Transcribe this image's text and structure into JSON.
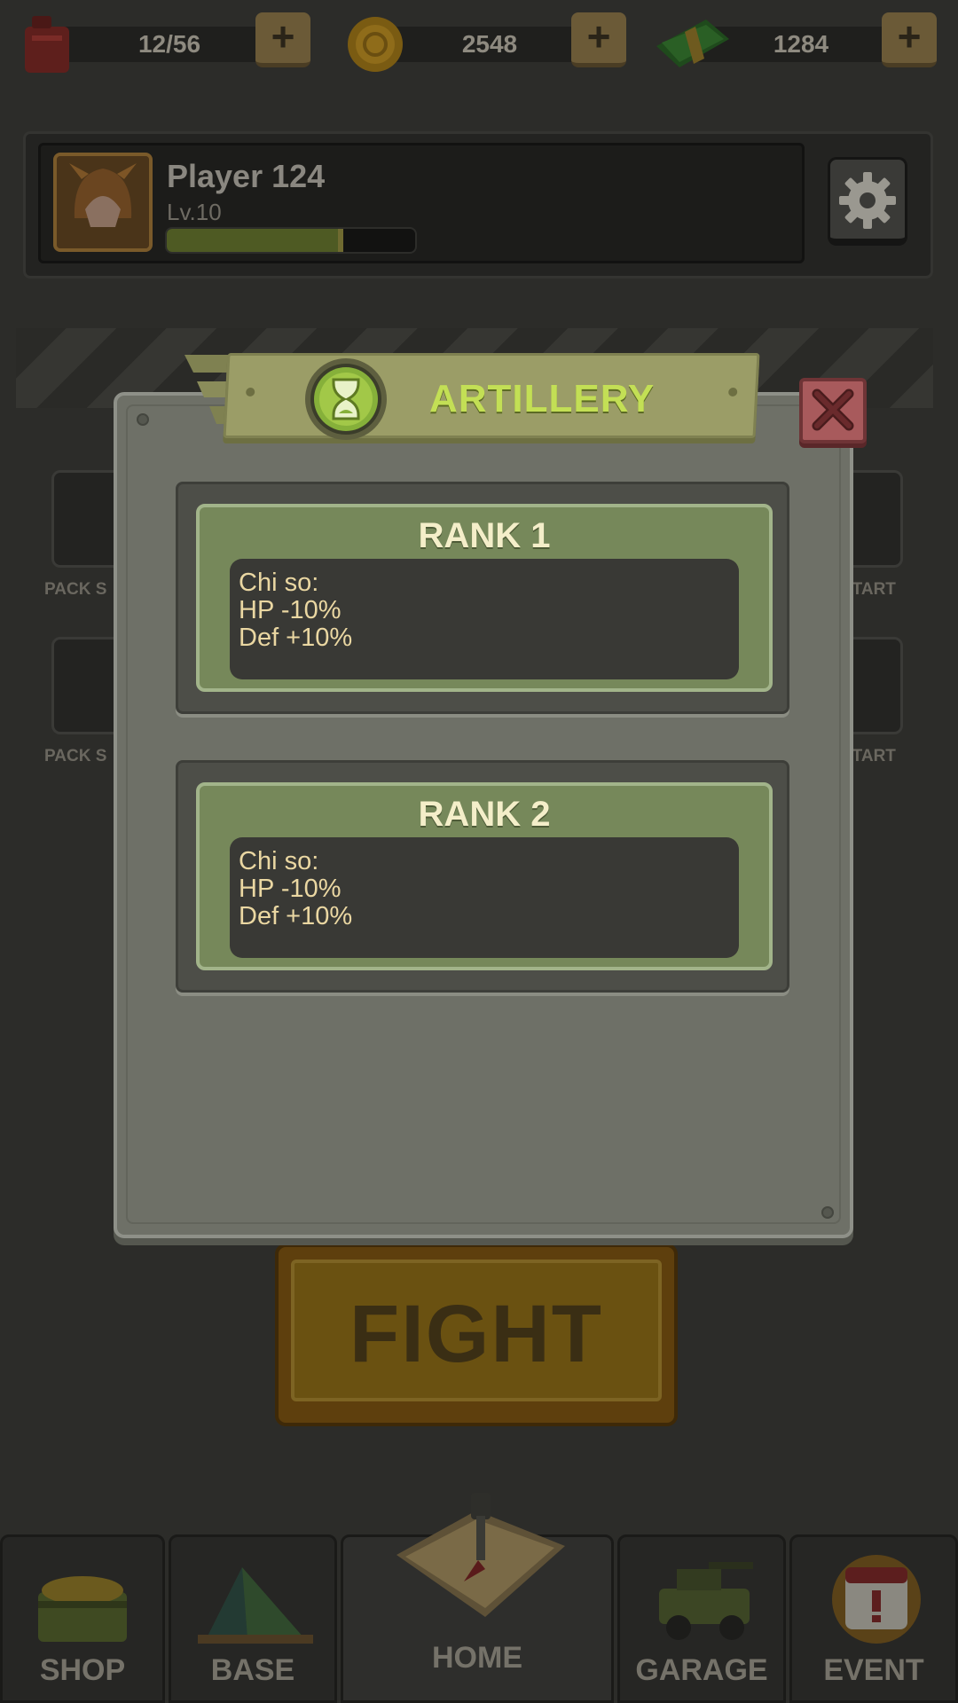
{
  "resources": {
    "fuel": {
      "value": "12/56",
      "icon": "fuel-can-icon"
    },
    "coins": {
      "value": "2548",
      "icon": "coin-icon"
    },
    "cash": {
      "value": "1284",
      "icon": "cash-icon"
    }
  },
  "profile": {
    "name": "Player 124",
    "level": "Lv.10",
    "xp_progress": 0.71
  },
  "background_labels": {
    "left_top": "PACK S",
    "left_bottom": "PACK S",
    "right_top": "START",
    "right_bottom": "START"
  },
  "fight_button": "FIGHT",
  "nav": {
    "shop": "SHOP",
    "base": "BASE",
    "home": "HOME",
    "garage": "GARAGE",
    "event": "EVENT"
  },
  "modal": {
    "title": "ARTILLERY",
    "icon": "hourglass-icon",
    "ranks": [
      {
        "title": "RANK 1",
        "lines": [
          "Chi so:",
          "HP -10%",
          "Def +10%"
        ]
      },
      {
        "title": "RANK 2",
        "lines": [
          "Chi so:",
          "HP -10%",
          "Def +10%"
        ]
      }
    ]
  },
  "colors": {
    "accent_green": "#c3df55",
    "card_green": "#76885a",
    "close_red": "#a85a5c",
    "text_cream": "#ead7a2"
  }
}
